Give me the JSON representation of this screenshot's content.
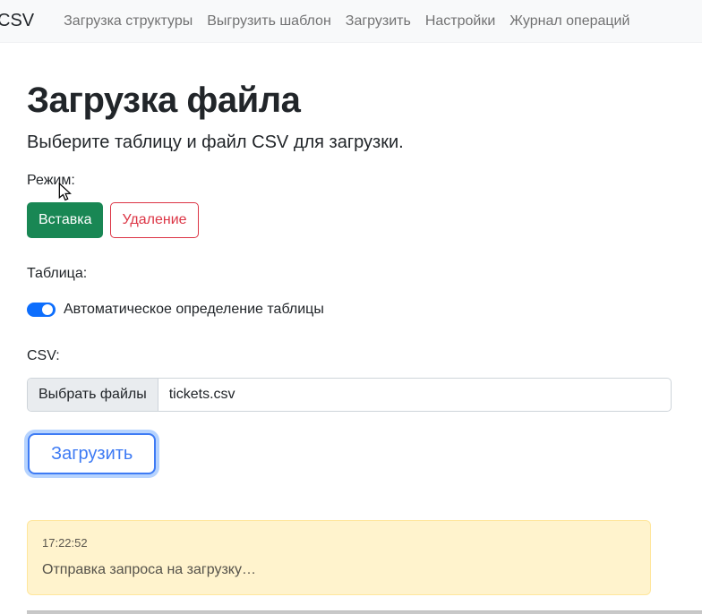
{
  "navbar": {
    "brand": "CSV",
    "items": [
      {
        "label": "Загрузка структуры"
      },
      {
        "label": "Выгрузить шаблон"
      },
      {
        "label": "Загрузить"
      },
      {
        "label": "Настройки"
      },
      {
        "label": "Журнал операций"
      }
    ]
  },
  "page": {
    "title": "Загрузка файла",
    "subtitle": "Выберите таблицу и файл CSV для загрузки."
  },
  "mode": {
    "label": "Режим:",
    "insert_button": "Вставка",
    "delete_button": "Удаление"
  },
  "table": {
    "label": "Таблица:",
    "auto_detect_label": "Автоматическое определение таблицы",
    "toggle_on": true
  },
  "csv": {
    "label": "CSV:",
    "choose_files_button": "Выбрать файлы",
    "file_name": "tickets.csv"
  },
  "upload": {
    "button_label": "Загрузить"
  },
  "log": {
    "timestamp": "17:22:52",
    "message": "Отправка запроса на загрузку…"
  },
  "colors": {
    "success_green": "#198754",
    "danger_red": "#dc3545",
    "primary_blue": "#0d6efd",
    "warning_alert_bg": "#fff3cd",
    "warning_alert_border": "#ffe69c",
    "navbar_bg": "#f8f9fa"
  }
}
